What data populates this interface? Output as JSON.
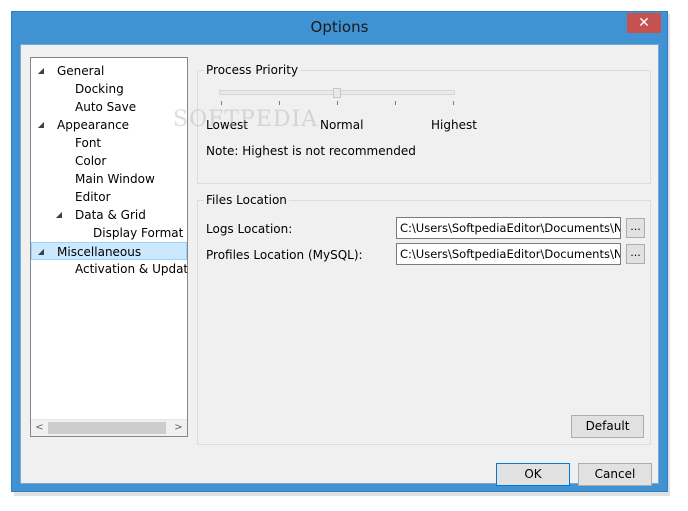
{
  "window": {
    "title": "Options",
    "close_glyph": "✕"
  },
  "tree": {
    "items": [
      {
        "label": "General",
        "expander": "◢"
      },
      {
        "label": "Docking"
      },
      {
        "label": "Auto Save"
      },
      {
        "label": "Appearance",
        "expander": "◢"
      },
      {
        "label": "Font"
      },
      {
        "label": "Color"
      },
      {
        "label": "Main Window"
      },
      {
        "label": "Editor"
      },
      {
        "label": "Data & Grid",
        "expander": "◢"
      },
      {
        "label": "Display Format"
      },
      {
        "label": "Miscellaneous",
        "expander": "◢",
        "selected": true
      },
      {
        "label": "Activation & Updater"
      }
    ],
    "scroll_left": "<",
    "scroll_right": ">"
  },
  "process_priority": {
    "title": "Process Priority",
    "lowest": "Lowest",
    "normal": "Normal",
    "highest": "Highest",
    "note": "Note: Highest is not recommended",
    "level": 0.5
  },
  "files_location": {
    "title": "Files Location",
    "logs_label": "Logs Location:",
    "logs_value": "C:\\Users\\SoftpediaEditor\\Documents\\Navicat",
    "profiles_label": "Profiles Location (MySQL):",
    "profiles_value": "C:\\Users\\SoftpediaEditor\\Documents\\Navicat",
    "browse_label": "...",
    "default_label": "Default"
  },
  "buttons": {
    "ok": "OK",
    "cancel": "Cancel"
  },
  "watermark": "SOFTPEDIA"
}
